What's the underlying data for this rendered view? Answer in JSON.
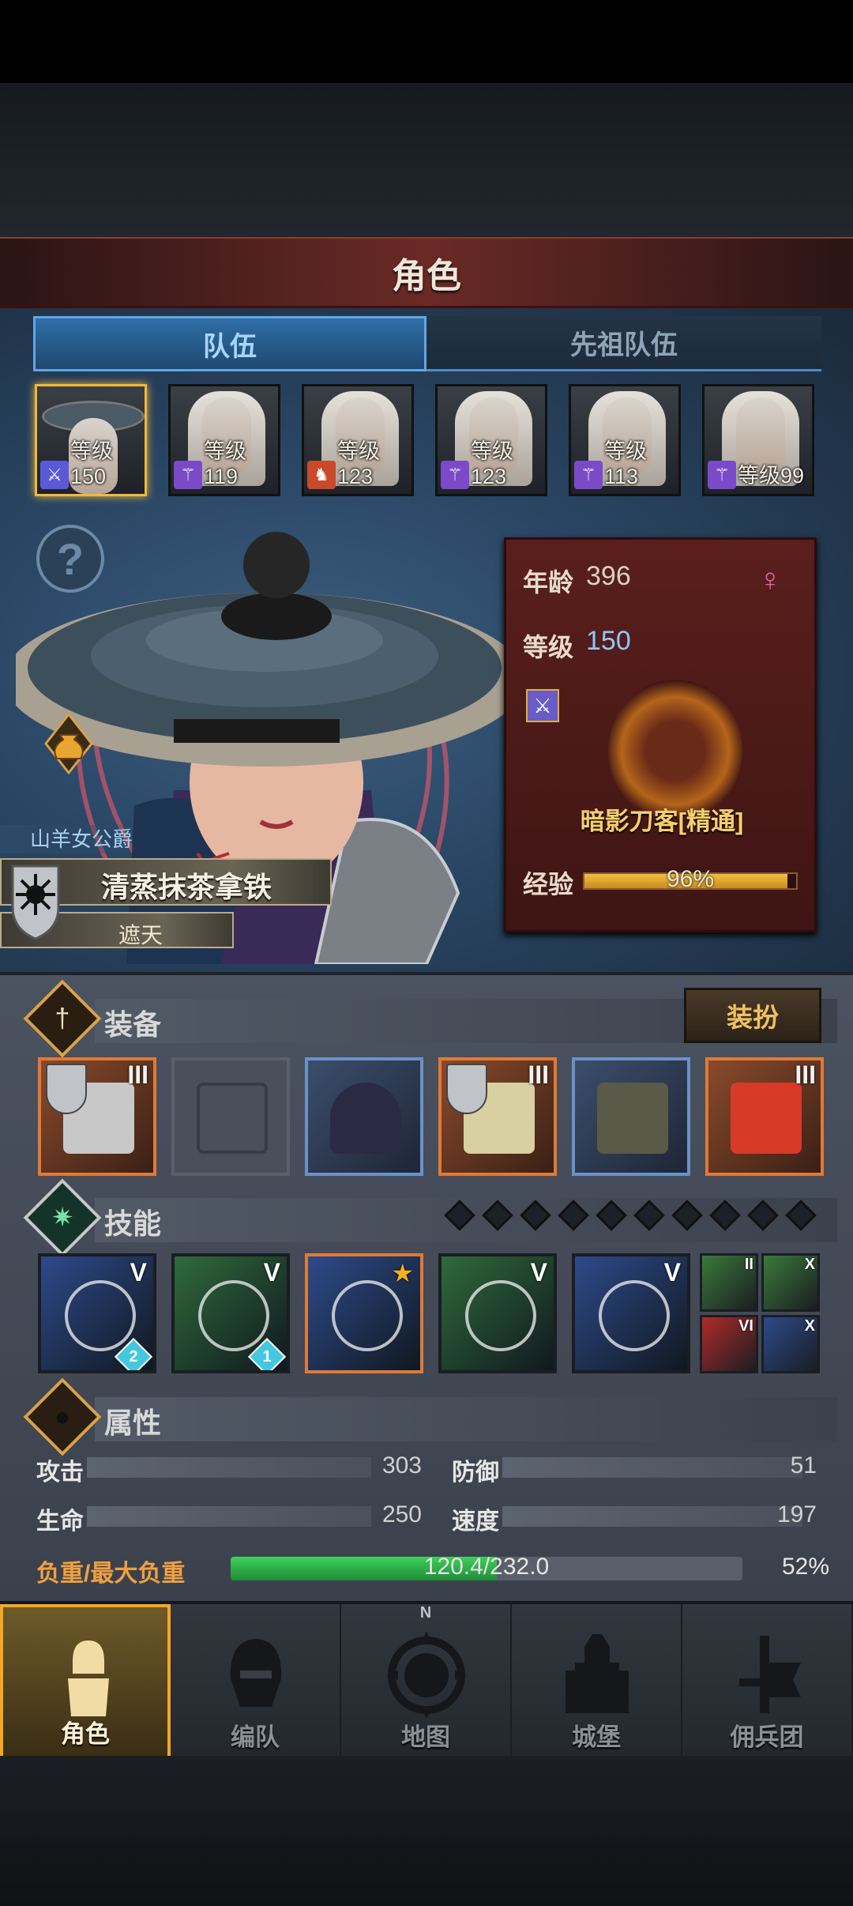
{
  "header": {
    "title": "角色"
  },
  "tabs": [
    {
      "label": "队伍",
      "active": true
    },
    {
      "label": "先祖队伍",
      "active": false
    }
  ],
  "party": [
    {
      "level": "等级150",
      "class_icon": "sword-icon",
      "selected": true
    },
    {
      "level": "等级119",
      "class_icon": "staff-icon",
      "selected": false
    },
    {
      "level": "等级123",
      "class_icon": "beast-icon",
      "selected": false
    },
    {
      "level": "等级123",
      "class_icon": "staff-icon",
      "selected": false
    },
    {
      "level": "等级113",
      "class_icon": "staff-icon",
      "selected": false
    },
    {
      "level": "等级99",
      "class_icon": "staff-icon",
      "selected": false
    }
  ],
  "hero": {
    "title": "山羊女公爵",
    "name": "清蒸抹茶拿铁",
    "subtitle": "遮天",
    "age_label": "年龄",
    "age": "396",
    "level_label": "等级",
    "level": "150",
    "gender_icon": "female-icon",
    "class_name": "暗影刀客[精通]",
    "exp_label": "经验",
    "exp_text": "96%",
    "exp_fraction": 0.96
  },
  "equipment": {
    "title": "装备",
    "dress_label": "装扮",
    "slots": [
      {
        "name": "sword-icon",
        "tier": "III",
        "rarity": "orange",
        "crest": true
      },
      {
        "name": "empty-shield-slot-icon",
        "tier": "",
        "rarity": "empty",
        "crest": false
      },
      {
        "name": "hood-icon",
        "tier": "",
        "rarity": "blue",
        "crest": false
      },
      {
        "name": "armor-icon",
        "tier": "III",
        "rarity": "orange",
        "crest": true
      },
      {
        "name": "boots-icon",
        "tier": "",
        "rarity": "blue",
        "crest": false
      },
      {
        "name": "amulet-icon",
        "tier": "III",
        "rarity": "orange",
        "crest": false
      }
    ]
  },
  "skills": {
    "title": "技能",
    "pips": 10,
    "slots": [
      {
        "name": "sword-aura-skill-icon",
        "rank": "V",
        "gem": "2",
        "bg": "#2d4a8a"
      },
      {
        "name": "dash-skill-icon",
        "rank": "V",
        "gem": "1",
        "bg": "#2f6a3a"
      },
      {
        "name": "spear-skill-icon",
        "rank": "★",
        "gem": "",
        "bg": "#2d4a8a"
      },
      {
        "name": "target-skill-icon",
        "rank": "V",
        "gem": "",
        "bg": "#2f6a3a"
      },
      {
        "name": "crystal-skill-icon",
        "rank": "V",
        "gem": "",
        "bg": "#2d4a8a"
      }
    ],
    "passives": [
      {
        "name": "burst-passive-icon",
        "rank": "II",
        "bg": "#3a7a3a"
      },
      {
        "name": "wind-passive-icon",
        "rank": "X",
        "bg": "#3a7a3a"
      },
      {
        "name": "blade-passive-icon",
        "rank": "VI",
        "bg": "#b02a2a"
      },
      {
        "name": "horse-passive-icon",
        "rank": "X",
        "bg": "#2d4a8a"
      }
    ]
  },
  "attributes": {
    "title": "属性",
    "stats": [
      {
        "label": "攻击",
        "value": "303"
      },
      {
        "label": "防御",
        "value": "51"
      },
      {
        "label": "生命",
        "value": "250"
      },
      {
        "label": "速度",
        "value": "197"
      }
    ],
    "load_label": "负重/最大负重",
    "load_text": "120.4/232.0",
    "load_pct": "52%",
    "load_fraction": 0.52
  },
  "nav": [
    {
      "label": "角色",
      "icon": "knight-icon",
      "active": true
    },
    {
      "label": "编队",
      "icon": "helmet-icon",
      "active": false
    },
    {
      "label": "地图",
      "icon": "compass-map-icon",
      "active": false
    },
    {
      "label": "城堡",
      "icon": "castle-icon",
      "active": false
    },
    {
      "label": "佣兵团",
      "icon": "banner-icon",
      "active": false
    }
  ],
  "map_compass_letter": "N"
}
